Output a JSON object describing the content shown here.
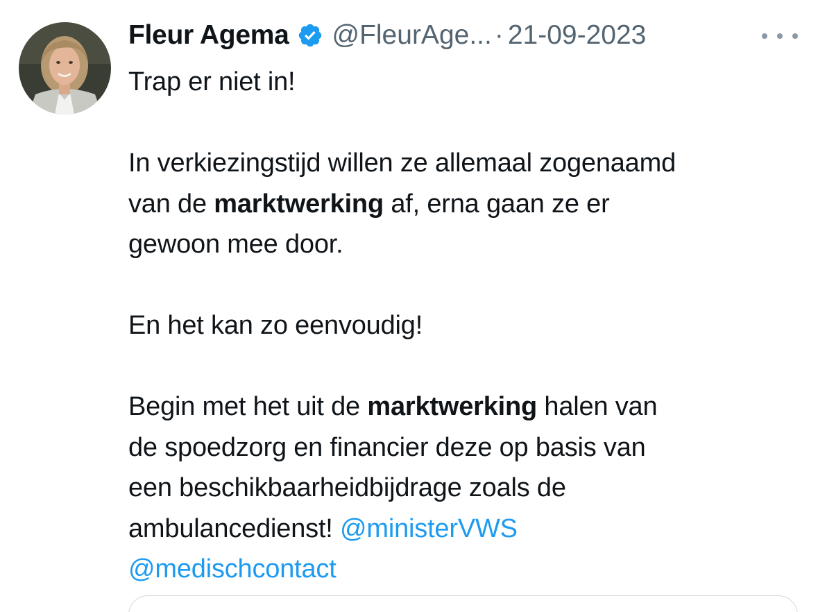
{
  "tweet": {
    "author_name": "Fleur Agema",
    "handle": "@FleurAge...",
    "separator": "·",
    "date": "21-09-2023",
    "verified_color": "#1d9bf0",
    "avatar": "profile-photo",
    "lines": {
      "l1": "Trap er niet in!",
      "l2": "In verkiezingstijd willen ze allemaal zogenaamd",
      "l3a": "van de ",
      "l3b": "marktwerking",
      "l3c": " af, erna gaan ze er",
      "l4": "gewoon mee door.",
      "l5": "En het kan zo eenvoudig!",
      "l6a": "Begin met het uit de ",
      "l6b": "marktwerking",
      "l6c": " halen van",
      "l7": "de spoedzorg en financier deze op basis van",
      "l8": "een beschikbaarheidbijdrage zoals de",
      "l9a": "ambulancedienst! ",
      "mention1": "@ministerVWS",
      "mention2": "@medischcontact"
    }
  },
  "colors": {
    "text": "#0f1419",
    "secondary": "#536471",
    "link": "#1d9bf0"
  }
}
